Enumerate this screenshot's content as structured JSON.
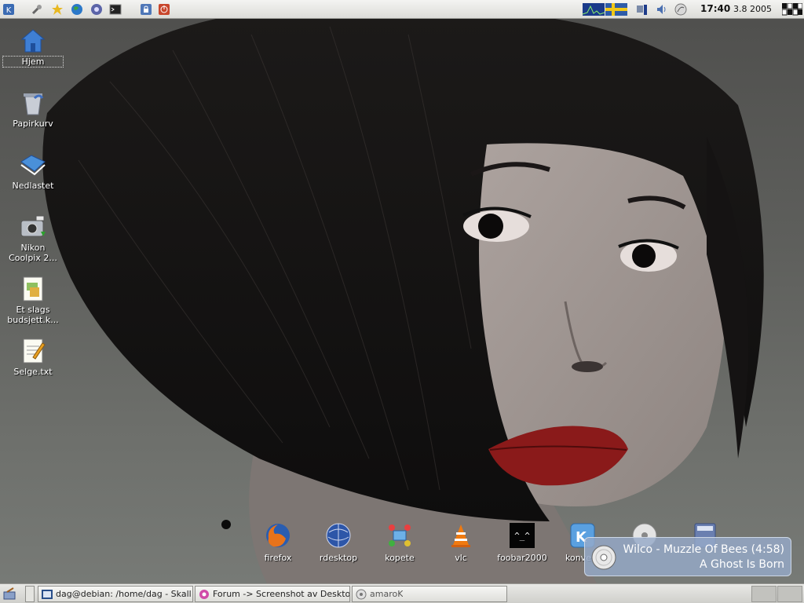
{
  "top_panel": {
    "launchers": [
      {
        "icon": "kde-menu-icon"
      },
      {
        "icon": "tools-icon"
      },
      {
        "icon": "star-icon"
      },
      {
        "icon": "globe-icon"
      },
      {
        "icon": "konqueror-icon"
      },
      {
        "icon": "terminal-icon"
      },
      {
        "icon": "lock-icon"
      },
      {
        "icon": "logout-icon"
      }
    ],
    "tray": [
      {
        "icon": "cpu-monitor-icon"
      },
      {
        "icon": "swedish-flag-icon"
      },
      {
        "icon": "network-icon"
      },
      {
        "icon": "volume-icon"
      },
      {
        "icon": "klipper-icon"
      }
    ],
    "clock_time": "17:40",
    "clock_date": "3.8 2005",
    "pager_icon": "virtual-desktops-icon"
  },
  "desktop_icons": [
    {
      "label": "Hjem",
      "icon": "home-icon"
    },
    {
      "label": "Papirkurv",
      "icon": "trash-icon"
    },
    {
      "label": "Nedlastet",
      "icon": "downloads-folder-icon"
    },
    {
      "label": "Nikon Coolpix 2...",
      "icon": "camera-icon"
    },
    {
      "label": "Et slags budsjett.k...",
      "icon": "spreadsheet-icon"
    },
    {
      "label": "Selge.txt",
      "icon": "text-file-icon"
    }
  ],
  "dock": [
    {
      "label": "firefox",
      "icon": "firefox-icon"
    },
    {
      "label": "rdesktop",
      "icon": "rdesktop-icon"
    },
    {
      "label": "kopete",
      "icon": "kopete-icon"
    },
    {
      "label": "vlc",
      "icon": "vlc-icon"
    },
    {
      "label": "foobar2000",
      "icon": "foobar2000-icon"
    },
    {
      "label": "konversation",
      "icon": "konversation-icon"
    },
    {
      "label": "",
      "icon": "cd-player-icon"
    },
    {
      "label": "",
      "icon": "calculator-icon"
    }
  ],
  "osd": {
    "title": "Wilco - Muzzle Of Bees (4:58)",
    "album": "A Ghost Is Born",
    "icon": "cd-disc-icon"
  },
  "taskbar": {
    "tasks": [
      {
        "label": "dag@debian: /home/dag - Skall",
        "icon": "terminal-icon"
      },
      {
        "label": "Forum -> Screenshot av Desktop",
        "icon": "browser-icon"
      },
      {
        "label": "amaroK",
        "icon": "amarok-icon"
      }
    ],
    "show_desktop_icon": "show-desktop-icon"
  },
  "colors": {
    "panel": "#dcdcd8",
    "osd": "#96aac8",
    "wallpaper": "#5e5f5c"
  }
}
